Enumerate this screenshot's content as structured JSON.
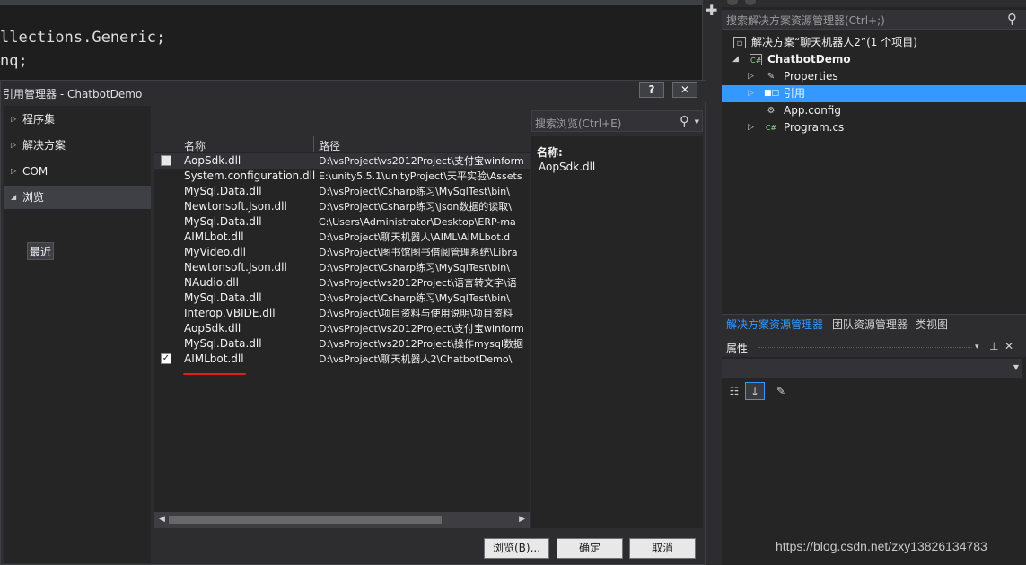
{
  "editor": {
    "code_lines": [
      "llections.Generic;",
      "nq;"
    ]
  },
  "solution_explorer": {
    "search_placeholder": "搜索解决方案资源管理器(Ctrl+;)",
    "tree": [
      {
        "label": "解决方案“聊天机器人2”(1 个项目)",
        "icon": "solution-icon"
      },
      {
        "label": "ChatbotDemo",
        "icon": "csharp-project-icon",
        "bold": true
      },
      {
        "label": "Properties",
        "icon": "wrench-icon"
      },
      {
        "label": "引用",
        "icon": "references-icon",
        "selected": true
      },
      {
        "label": "App.config",
        "icon": "config-file-icon"
      },
      {
        "label": "Program.cs",
        "icon": "csharp-file-icon"
      }
    ],
    "tabs": [
      "解决方案资源管理器",
      "团队资源管理器",
      "类视图"
    ]
  },
  "properties": {
    "title": "属性"
  },
  "dialog": {
    "title": "引用管理器 - ChatbotDemo",
    "help_label": "?",
    "close_label": "✕",
    "nav": [
      {
        "label": "程序集",
        "expanded": false
      },
      {
        "label": "解决方案",
        "expanded": false
      },
      {
        "label": "COM",
        "expanded": false
      },
      {
        "label": "浏览",
        "expanded": true,
        "selected": true
      }
    ],
    "nav_sub": "最近",
    "search_placeholder": "搜索浏览(Ctrl+E)",
    "columns": {
      "name": "名称",
      "path": "路径"
    },
    "rows": [
      {
        "name": "AopSdk.dll",
        "path": "D:\\vsProject\\vs2012Project\\支付宝winform",
        "checked": false,
        "hover": true
      },
      {
        "name": "System.configuration.dll",
        "path": "E:\\unity5.5.1\\unityProject\\天平实验\\Assets",
        "checked": false
      },
      {
        "name": "MySql.Data.dll",
        "path": "D:\\vsProject\\Csharp练习\\MySqlTest\\bin\\",
        "checked": false
      },
      {
        "name": "Newtonsoft.Json.dll",
        "path": "D:\\vsProject\\Csharp练习\\json数据的读取\\",
        "checked": false
      },
      {
        "name": "MySql.Data.dll",
        "path": "C:\\Users\\Administrator\\Desktop\\ERP-ma",
        "checked": false
      },
      {
        "name": "AIMLbot.dll",
        "path": "D:\\vsProject\\聊天机器人\\AIML\\AIMLbot.d",
        "checked": false
      },
      {
        "name": "MyVideo.dll",
        "path": "D:\\vsProject\\图书馆图书借阅管理系统\\Libra",
        "checked": false
      },
      {
        "name": "Newtonsoft.Json.dll",
        "path": "D:\\vsProject\\Csharp练习\\MySqlTest\\bin\\",
        "checked": false
      },
      {
        "name": "NAudio.dll",
        "path": "D:\\vsProject\\vs2012Project\\语言转文字\\语",
        "checked": false
      },
      {
        "name": "MySql.Data.dll",
        "path": "D:\\vsProject\\Csharp练习\\MySqlTest\\bin\\",
        "checked": false
      },
      {
        "name": "Interop.VBIDE.dll",
        "path": "D:\\vsProject\\项目资料与使用说明\\项目资料",
        "checked": false
      },
      {
        "name": "AopSdk.dll",
        "path": "D:\\vsProject\\vs2012Project\\支付宝winform",
        "checked": false
      },
      {
        "name": "MySql.Data.dll",
        "path": "D:\\vsProject\\vs2012Project\\操作mysql数据",
        "checked": false
      },
      {
        "name": "AIMLbot.dll",
        "path": "D:\\vsProject\\聊天机器人2\\ChatbotDemo\\",
        "checked": true
      }
    ],
    "detail": {
      "key": "名称:",
      "value": "AopSdk.dll"
    },
    "buttons": {
      "browse": "浏览(B)...",
      "ok": "确定",
      "cancel": "取消"
    }
  },
  "watermark": "https://blog.csdn.net/zxy13826134783",
  "colors": {
    "accent": "#3399ff",
    "selection": "#3399ff",
    "annotation_red": "#e0201e"
  }
}
